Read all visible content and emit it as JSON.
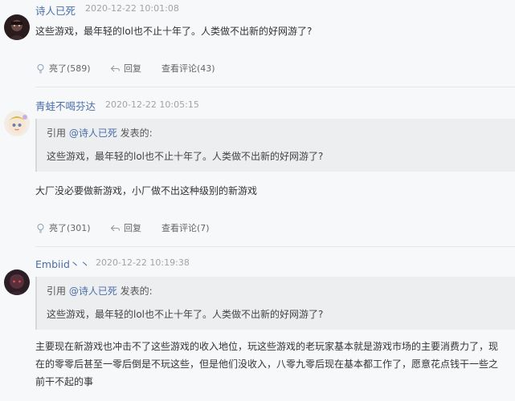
{
  "comments": [
    {
      "author": "诗人已死",
      "time": "2020-12-22 10:01:08",
      "text": "这些游戏，最年轻的lol也不止十年了。人类做不出新的好网游了?",
      "like": "亮了(589)",
      "reply": "回复",
      "view": "查看评论(43)"
    },
    {
      "author": "青蛙不喝芬达",
      "time": "2020-12-22 10:05:15",
      "quote": {
        "prefix": "引用 ",
        "user": "@诗人已死",
        "suffix": " 发表的:",
        "text": "这些游戏，最年轻的lol也不止十年了。人类做不出新的好网游了?"
      },
      "text": "大厂没必要做新游戏，小厂做不出这种级别的新游戏",
      "like": "亮了(301)",
      "reply": "回复",
      "view": "查看评论(7)"
    },
    {
      "author": "Embiid丶丶",
      "time": "2020-12-22 10:19:38",
      "quote": {
        "prefix": "引用 ",
        "user": "@诗人已死",
        "suffix": " 发表的:",
        "text": "这些游戏，最年轻的lol也不止十年了。人类做不出新的好网游了?"
      },
      "lines": [
        "主要现在新游戏也冲击不了这些游戏的收入地位，玩这些游戏的老玩家基本就是游戏市场的主要消费力了，现",
        "在的零零后甚至一零后倒是不玩这些，但是他们没收入，八零九零后现在基本都工作了，愿意花点钱干一些之",
        "前干不起的事"
      ]
    }
  ],
  "colors": {
    "username": "#4a6ea8",
    "time": "#a3a3a3",
    "quote_bg": "#edeef0"
  },
  "icons": [
    "lightbulb-icon",
    "reply-arrow-icon"
  ]
}
